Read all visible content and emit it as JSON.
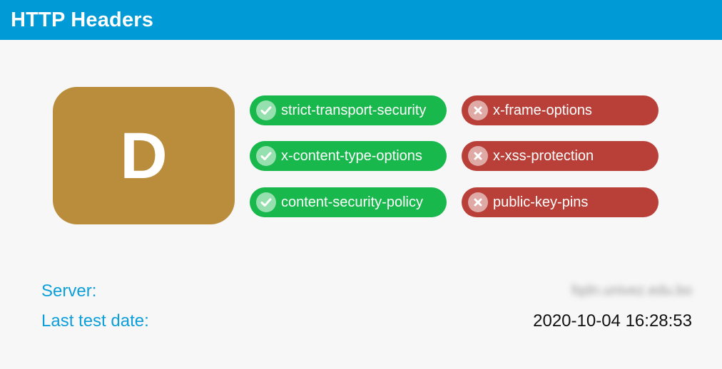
{
  "header": {
    "title": "HTTP Headers"
  },
  "grade": {
    "letter": "D",
    "color": "#b98d3b"
  },
  "headers_present": [
    {
      "label": "strict-transport-security",
      "status": "pass",
      "icon": "check-icon"
    },
    {
      "label": "x-content-type-options",
      "status": "pass",
      "icon": "check-icon"
    },
    {
      "label": "content-security-policy",
      "status": "pass",
      "icon": "check-icon"
    }
  ],
  "headers_missing": [
    {
      "label": "x-frame-options",
      "status": "fail",
      "icon": "cross-icon"
    },
    {
      "label": "x-xss-protection",
      "status": "fail",
      "icon": "cross-icon"
    },
    {
      "label": "public-key-pins",
      "status": "fail",
      "icon": "cross-icon"
    }
  ],
  "info": {
    "server_label": "Server:",
    "server_value": "fqdn.univez.edu.bo",
    "date_label": "Last test date:",
    "date_value": "2020-10-04 16:28:53"
  },
  "colors": {
    "accent": "#009ad6",
    "pass": "#18b84c",
    "fail": "#b94038",
    "label": "#0d9fd9"
  }
}
